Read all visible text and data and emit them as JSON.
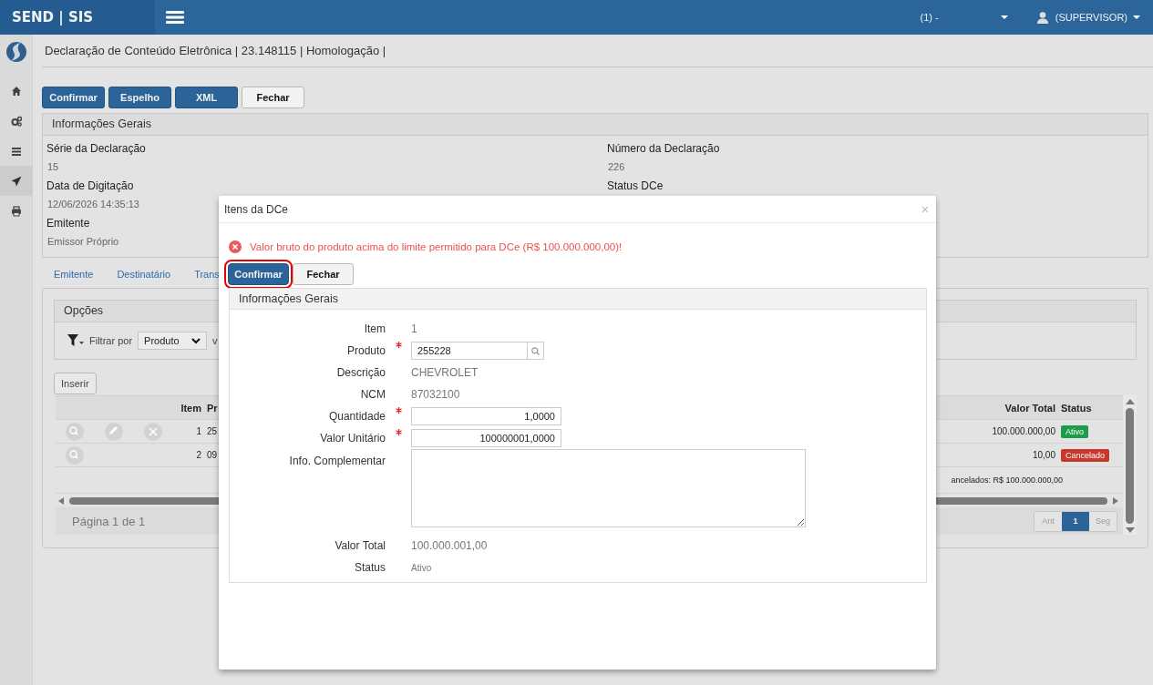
{
  "app": {
    "brand": "SEND | SIS",
    "company": "(1) -",
    "user": "(SUPERVISOR)"
  },
  "sidebar": {
    "items": [
      {
        "kind": "home",
        "selected": false
      },
      {
        "kind": "gears",
        "selected": false
      },
      {
        "kind": "list",
        "selected": false
      },
      {
        "kind": "send",
        "selected": true
      },
      {
        "kind": "print",
        "selected": false
      }
    ]
  },
  "page_title": "Declaração de Conteúdo Eletrônica | 23.148115 | Homologação |",
  "toolbar": [
    {
      "label": "Confirmar",
      "kind": "primary"
    },
    {
      "label": "Espelho",
      "kind": "primary"
    },
    {
      "label": "XML",
      "kind": "primary"
    },
    {
      "label": "Fechar",
      "kind": "default"
    }
  ],
  "general_info": {
    "title": "Informações Gerais",
    "columns": [
      [
        {
          "label": "Série da Declaração",
          "value": "15"
        },
        {
          "label": "Data de Digitação",
          "value": "12/06/2026 14:35:13"
        },
        {
          "label": "Emitente",
          "value": "Emissor Próprio"
        }
      ],
      [
        {
          "label": "Número da Declaração",
          "value": "226"
        },
        {
          "label": "Status DCe"
        }
      ]
    ]
  },
  "tabs": [
    "Emitente",
    "Destinatário",
    "Trans"
  ],
  "options": {
    "title": "Opções",
    "filter_label": "Filtrar por",
    "filter_value": "Produto",
    "cut_label": "v"
  },
  "insert_button": "Inserir",
  "grid": {
    "columns": {
      "item": "Item",
      "product": "Pr",
      "total": "Valor Total",
      "status": "Status"
    },
    "rows": [
      {
        "actions": [
          {
            "kind": "view"
          },
          {
            "kind": "edit"
          },
          {
            "kind": "delete"
          }
        ],
        "item": "1",
        "product": "25",
        "total": "100.000.000,00",
        "status": "Ativo",
        "color": "#1e9b4b"
      },
      {
        "actions": [
          {
            "kind": "view"
          }
        ],
        "item": "2",
        "product": "09",
        "total": "10,00",
        "status": "Cancelado",
        "color": "#c9372c"
      }
    ],
    "summary": "ancelados: R$ 100.000.000,00",
    "paging": "Página 1 de 1",
    "pages": [
      {
        "label": "Ant",
        "selected": false
      },
      {
        "label": "1",
        "selected": true
      },
      {
        "label": "Seg",
        "selected": false
      }
    ]
  },
  "modal": {
    "title": "Itens da DCe",
    "close": "×",
    "error": "Valor bruto do produto acima do limite permitido para DCe (R$ 100.000.000,00)!",
    "buttons": [
      {
        "label": "Confirmar",
        "kind": "primary",
        "focused": true
      },
      {
        "label": "Fechar",
        "kind": "default",
        "focused": false
      }
    ],
    "section": "Informações Gerais",
    "fields": [
      {
        "label": "Item",
        "kind": "text",
        "required": false,
        "value": "1"
      },
      {
        "label": "Produto",
        "kind": "lookup",
        "required": true,
        "value": "255228"
      },
      {
        "label": "Descrição",
        "kind": "text",
        "required": false,
        "value": "CHEVROLET"
      },
      {
        "label": "NCM",
        "kind": "text",
        "required": false,
        "value": "87032100"
      },
      {
        "label": "Quantidade",
        "kind": "number",
        "required": true,
        "value": "1,0000"
      },
      {
        "label": "Valor Unitário",
        "kind": "number",
        "required": true,
        "value": "100000001,0000"
      },
      {
        "label": "Info. Complementar",
        "kind": "textarea",
        "required": false
      },
      {
        "label": "Valor Total",
        "kind": "text",
        "required": false,
        "value": "100.000.001,00"
      },
      {
        "label": "Status",
        "kind": "small",
        "required": false,
        "value": "Ativo"
      }
    ]
  }
}
